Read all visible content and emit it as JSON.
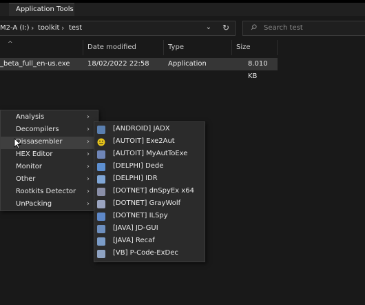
{
  "ribbon": {
    "tab_label": "Application Tools"
  },
  "address": {
    "crumbs": [
      "M2-A (I:)",
      "toolkit",
      "test"
    ],
    "separator": "›",
    "dropdown_glyph": "⌄",
    "refresh_glyph": "↻"
  },
  "search": {
    "placeholder": "Search test"
  },
  "columns": {
    "sort_glyph": "^",
    "date_modified": "Date modified",
    "type": "Type",
    "size": "Size"
  },
  "files": [
    {
      "name": "_beta_full_en-us.exe",
      "date": "18/02/2022 22:58",
      "type": "Application",
      "size": "8.010 KB"
    }
  ],
  "context_menu": {
    "arrow_glyph": "›",
    "items": [
      "Analysis",
      "Decompilers",
      "Dissasembler",
      "HEX Editor",
      "Monitor",
      "Other",
      "Rootkits Detector",
      "UnPacking"
    ]
  },
  "submenu": {
    "items": [
      {
        "label": "[ANDROID] JADX",
        "icon": "jadx-icon",
        "color": "#5a7fb0"
      },
      {
        "label": "[AUTOIT] Exe2Aut",
        "icon": "smiley-icon",
        "color": "#e8c51a"
      },
      {
        "label": "[AUTOIT] MyAutToExe",
        "icon": "myauttoexe-icon",
        "color": "#6f86b8"
      },
      {
        "label": "[DELPHI] Dede",
        "icon": "dede-icon",
        "color": "#5d8fd0"
      },
      {
        "label": "[DELPHI] IDR",
        "icon": "idr-icon",
        "color": "#7fa6d6"
      },
      {
        "label": "[DOTNET] dnSpyEx x64",
        "icon": "dnspy-icon",
        "color": "#8a8fa8"
      },
      {
        "label": "[DOTNET] GrayWolf",
        "icon": "graywolf-icon",
        "color": "#9aa4c0"
      },
      {
        "label": "[DOTNET] ILSpy",
        "icon": "ilspy-icon",
        "color": "#5e88c8"
      },
      {
        "label": "[JAVA] JD-GUI",
        "icon": "jdgui-icon",
        "color": "#6d8fbf"
      },
      {
        "label": "[JAVA] Recaf",
        "icon": "recaf-icon",
        "color": "#7b9cc8"
      },
      {
        "label": "[VB] P-Code-ExDec",
        "icon": "pcode-icon",
        "color": "#8ea2c2"
      }
    ]
  }
}
